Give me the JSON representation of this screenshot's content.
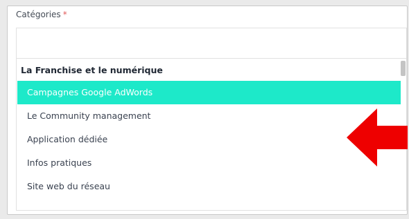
{
  "field": {
    "label": "Catégories",
    "required_marker": "*",
    "search_value": ""
  },
  "dropdown": {
    "group_label": "La Franchise et le numérique",
    "options": [
      {
        "label": "Campagnes Google AdWords",
        "highlighted": true
      },
      {
        "label": "Le Community management",
        "highlighted": false
      },
      {
        "label": "Application dédiée",
        "highlighted": false
      },
      {
        "label": "Infos pratiques",
        "highlighted": false
      },
      {
        "label": "Site web du réseau",
        "highlighted": false
      }
    ]
  },
  "colors": {
    "highlight": "#1de9c9",
    "arrow": "#ee0000",
    "required": "#e15a5a"
  },
  "annotation": {
    "icon": "red-arrow-left-icon"
  }
}
